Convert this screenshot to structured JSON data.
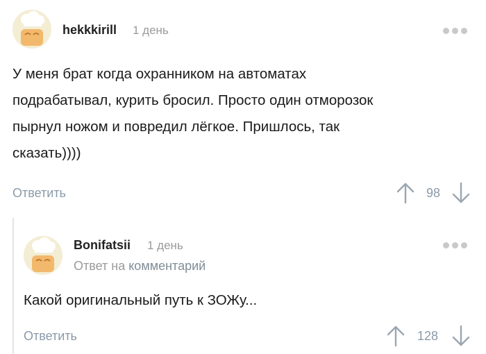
{
  "comment": {
    "username": "hekkkirill",
    "time": "1 день",
    "body_lines": [
      "У меня брат когда охранником на автоматах",
      "подрабатывал, курить бросил. Просто один отморозок",
      "пырнул ножом и повредил лёгкое. Пришлось, так",
      "сказать))))"
    ],
    "reply_label": "Ответить",
    "rating": "98",
    "avatar_icon": "chef-avatar-icon",
    "menu_icon": "more-dots-icon"
  },
  "reply": {
    "username": "Bonifatsii",
    "time": "1 день",
    "reply_to_prefix": "Ответ на",
    "reply_to_link": "комментарий",
    "body": "Какой оригинальный путь к ЗОЖу...",
    "reply_label": "Ответить",
    "rating": "128",
    "avatar_icon": "chef-avatar-icon",
    "menu_icon": "more-dots-icon"
  },
  "colors": {
    "meta_gray": "#9a9a9a",
    "action_blue_gray": "#8a9aa8",
    "thread_line": "#e3e3e3",
    "avatar_bg": "#f3edd4"
  }
}
